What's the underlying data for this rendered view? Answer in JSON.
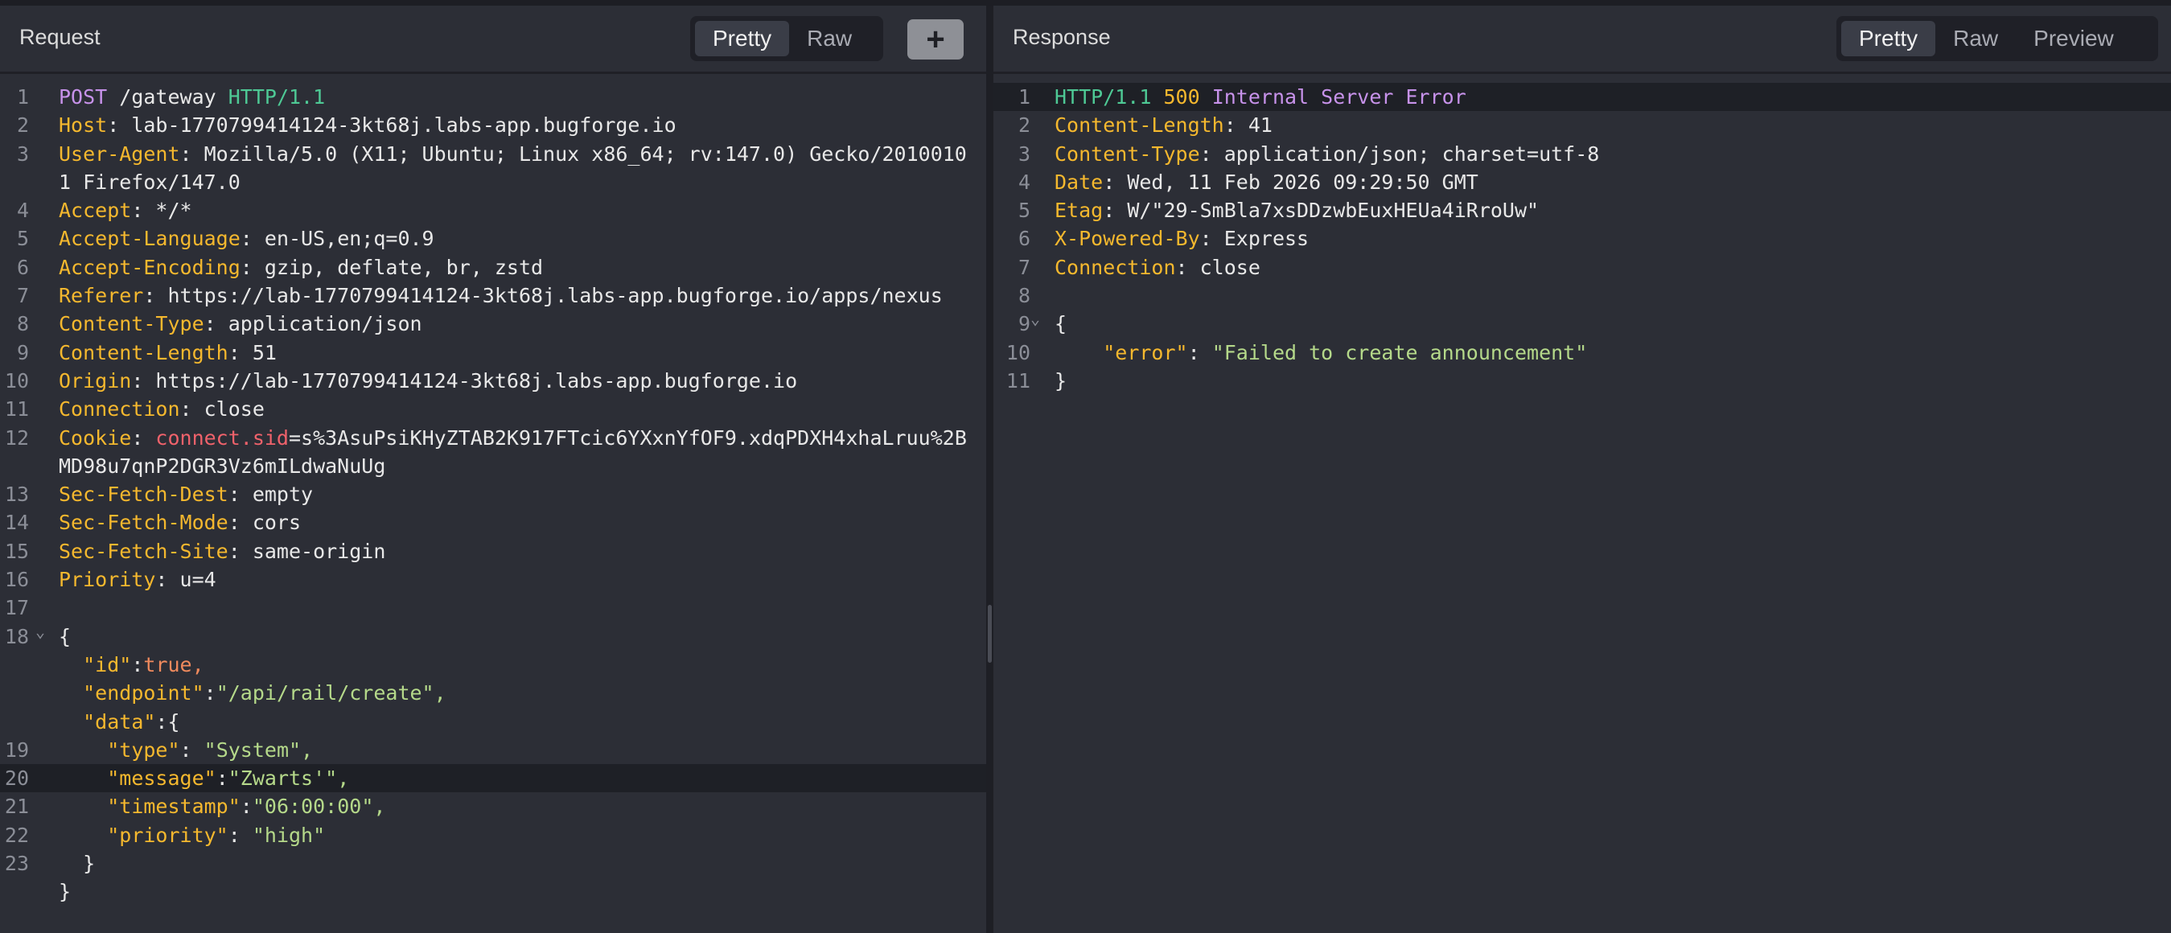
{
  "request": {
    "title": "Request",
    "tabs": [
      "Pretty",
      "Raw"
    ],
    "active_tab": "Pretty",
    "add_label": "+",
    "lines": [
      {
        "n": "1",
        "method": "POST",
        "path": " /gateway ",
        "proto": "HTTP/1.1"
      },
      {
        "n": "2",
        "name": "Host",
        "value": "lab-1770799414124-3kt68j.labs-app.bugforge.io"
      },
      {
        "n": "3",
        "name": "User-Agent",
        "value": "Mozilla/5.0 (X11; Ubuntu; Linux x86_64; rv:147.0) Gecko/2010010"
      },
      {
        "n": "",
        "cont": "1 Firefox/147.0"
      },
      {
        "n": "4",
        "name": "Accept",
        "value": "*/*"
      },
      {
        "n": "5",
        "name": "Accept-Language",
        "value": "en-US,en;q=0.9"
      },
      {
        "n": "6",
        "name": "Accept-Encoding",
        "value": "gzip, deflate, br, zstd"
      },
      {
        "n": "7",
        "name": "Referer",
        "value": "https://lab-1770799414124-3kt68j.labs-app.bugforge.io/apps/nexus"
      },
      {
        "n": "8",
        "name": "Content-Type",
        "value": "application/json"
      },
      {
        "n": "9",
        "name": "Content-Length",
        "value": "51"
      },
      {
        "n": "10",
        "name": "Origin",
        "value": "https://lab-1770799414124-3kt68j.labs-app.bugforge.io"
      },
      {
        "n": "11",
        "name": "Connection",
        "value": "close"
      },
      {
        "n": "12",
        "name": "Cookie",
        "cookie_name": "connect.sid",
        "value": "=s%3AsuPsiKHyZTAB2K917FTcic6YXxnYfOF9.xdqPDXH4xhaLruu%2B"
      },
      {
        "n": "",
        "cont": "MD98u7qnP2DGR3Vz6mILdwaNuUg"
      },
      {
        "n": "13",
        "name": "Sec-Fetch-Dest",
        "value": "empty"
      },
      {
        "n": "14",
        "name": "Sec-Fetch-Mode",
        "value": "cors"
      },
      {
        "n": "15",
        "name": "Sec-Fetch-Site",
        "value": "same-origin"
      },
      {
        "n": "16",
        "name": "Priority",
        "value": "u=4"
      },
      {
        "n": "17",
        "blank": true
      },
      {
        "n": "18",
        "fold": true,
        "json": [
          {
            "t": "pu",
            "v": "{"
          }
        ]
      },
      {
        "n": "",
        "indent": "  ",
        "json": [
          {
            "t": "jk",
            "v": "\"id\""
          },
          {
            "t": "pu",
            "v": ":"
          },
          {
            "t": "jb",
            "v": "true,"
          }
        ]
      },
      {
        "n": "",
        "indent": "  ",
        "json": [
          {
            "t": "jk",
            "v": "\"endpoint\""
          },
          {
            "t": "pu",
            "v": ":"
          },
          {
            "t": "js",
            "v": "\"/api/rail/create\","
          }
        ]
      },
      {
        "n": "",
        "indent": "  ",
        "json": [
          {
            "t": "jk",
            "v": "\"data\""
          },
          {
            "t": "pu",
            "v": ":{"
          }
        ]
      },
      {
        "n": "19",
        "indent": "    ",
        "json": [
          {
            "t": "jk",
            "v": "\"type\""
          },
          {
            "t": "pu",
            "v": ": "
          },
          {
            "t": "js",
            "v": "\"System\","
          }
        ]
      },
      {
        "n": "20",
        "indent": "    ",
        "hl": true,
        "json": [
          {
            "t": "jk",
            "v": "\"message\""
          },
          {
            "t": "pu",
            "v": ":"
          },
          {
            "t": "js",
            "v": "\"Zwarts'\","
          }
        ]
      },
      {
        "n": "21",
        "indent": "    ",
        "json": [
          {
            "t": "jk",
            "v": "\"timestamp\""
          },
          {
            "t": "pu",
            "v": ":"
          },
          {
            "t": "js",
            "v": "\"06:00:00\","
          }
        ]
      },
      {
        "n": "22",
        "indent": "    ",
        "json": [
          {
            "t": "jk",
            "v": "\"priority\""
          },
          {
            "t": "pu",
            "v": ": "
          },
          {
            "t": "js",
            "v": "\"high\""
          }
        ]
      },
      {
        "n": "23",
        "indent": "  ",
        "json": [
          {
            "t": "pu",
            "v": "}"
          }
        ]
      },
      {
        "n": "",
        "json": [
          {
            "t": "pu",
            "v": "}"
          }
        ]
      }
    ]
  },
  "response": {
    "title": "Response",
    "tabs": [
      "Pretty",
      "Raw",
      "Preview"
    ],
    "active_tab": "Pretty",
    "lines": [
      {
        "n": "1",
        "hl": true,
        "status": {
          "proto": "HTTP/1.1",
          "code": " 500 ",
          "reason": "Internal Server Error"
        }
      },
      {
        "n": "2",
        "name": "Content-Length",
        "value": "41"
      },
      {
        "n": "3",
        "name": "Content-Type",
        "value": "application/json; charset=utf-8"
      },
      {
        "n": "4",
        "name": "Date",
        "value": "Wed, 11 Feb 2026 09:29:50 GMT"
      },
      {
        "n": "5",
        "name": "Etag",
        "value": "W/\"29-SmBla7xsDDzwbEuxHEUa4iRroUw\""
      },
      {
        "n": "6",
        "name": "X-Powered-By",
        "value": "Express"
      },
      {
        "n": "7",
        "name": "Connection",
        "value": "close"
      },
      {
        "n": "8",
        "blank": true
      },
      {
        "n": "9",
        "fold": true,
        "json": [
          {
            "t": "pu",
            "v": "{"
          }
        ]
      },
      {
        "n": "10",
        "indent": "    ",
        "json": [
          {
            "t": "jk",
            "v": "\"error\""
          },
          {
            "t": "pu",
            "v": ": "
          },
          {
            "t": "js",
            "v": "\"Failed to create announcement\""
          }
        ]
      },
      {
        "n": "11",
        "json": [
          {
            "t": "pu",
            "v": "}"
          }
        ]
      }
    ]
  },
  "colors": {
    "background": "#2c2e36",
    "header_name": "#f5b82e",
    "string": "#b5d98a",
    "method": "#c792ea",
    "protocol": "#4ec995",
    "cookie_name": "#f0626b"
  }
}
